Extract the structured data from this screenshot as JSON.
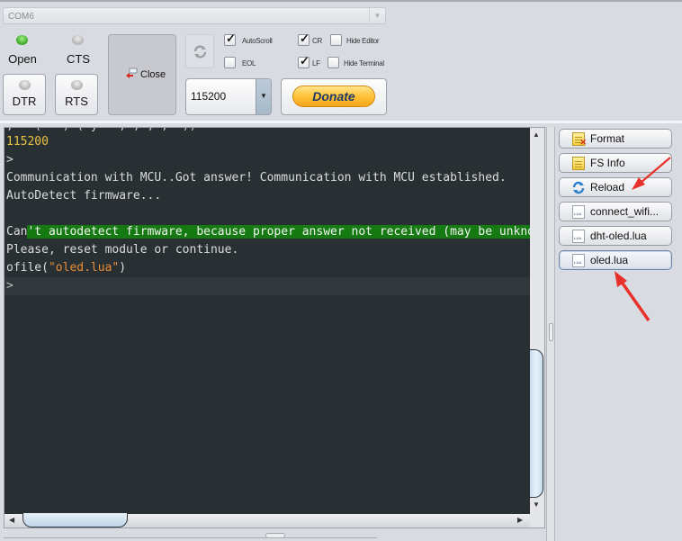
{
  "port": {
    "selected": "COM6",
    "caret_icon": "chevron-down-icon"
  },
  "signals": {
    "open": {
      "label": "Open",
      "state": "on",
      "color": "#3aa52b"
    },
    "cts": {
      "label": "CTS",
      "state": "off"
    },
    "dtr": {
      "label": "DTR",
      "state": "off"
    },
    "rts": {
      "label": "RTS",
      "state": "off"
    }
  },
  "close_button": {
    "label": "Close"
  },
  "options": {
    "autoscroll": {
      "label": "AutoScroll",
      "checked": true
    },
    "eol": {
      "label": "EOL",
      "checked": false
    },
    "cr": {
      "label": "CR",
      "checked": true
    },
    "lf": {
      "label": "LF",
      "checked": true
    },
    "hide_editor": {
      "label": "Hide Editor",
      "checked": false
    },
    "hide_terminal": {
      "label": "Hide Terminal",
      "checked": false
    }
  },
  "check_glyph": "✓",
  "baud": {
    "selected": "115200",
    "caret": "▼"
  },
  "donate": {
    "label": "Donate"
  },
  "terminal": {
    "lines": [
      {
        "text": ", ' (   ) ( y   , , , ,  ))",
        "clipped": true
      },
      {
        "text": "115200",
        "style": "yellow"
      },
      {
        "text": ">"
      },
      {
        "text": "Communication with MCU..Got answer! Communication with MCU established."
      },
      {
        "text": "AutoDetect firmware..."
      },
      {
        "text": ""
      },
      {
        "prefix": "Can",
        "highlight": "'t autodetect firmware, because proper answer not received (may be unknown firmware)."
      },
      {
        "text": "Please, reset module or continue."
      },
      {
        "func": "ofile(",
        "string": "\"oled.lua\"",
        "close": ")"
      },
      {
        "text": ">",
        "current": true
      }
    ],
    "scroll_up": "▲",
    "scroll_down": "▼",
    "scroll_left": "◀",
    "scroll_right": "▶"
  },
  "sidebar": {
    "buttons": [
      {
        "label": "Format",
        "icon": "format-icon"
      },
      {
        "label": "FS Info",
        "icon": "fs-info-icon"
      },
      {
        "label": "Reload",
        "icon": "reload-icon"
      },
      {
        "label": "connect_wifi...",
        "icon": "lua-file-icon",
        "icon_text": "LUA"
      },
      {
        "label": "dht-oled.lua",
        "icon": "lua-file-icon",
        "icon_text": "LUA"
      },
      {
        "label": "oled.lua",
        "icon": "lua-file-icon",
        "icon_text": "LUA",
        "active": true
      }
    ]
  },
  "annotations": {
    "arrow_color": "#e8312a"
  }
}
